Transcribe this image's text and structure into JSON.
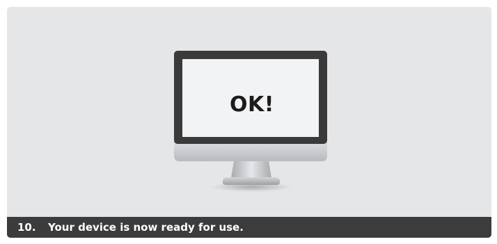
{
  "monitor": {
    "screen_message": "OK!",
    "icon": "desktop-monitor-icon"
  },
  "caption": {
    "step_number": "10.",
    "text": "Your device is now ready for use."
  },
  "colors": {
    "background": "#e5e6e8",
    "caption_bar": "#3c3c3c",
    "caption_text": "#ffffff",
    "screen": "#f2f3f5",
    "bezel": "#3a3a3a"
  }
}
